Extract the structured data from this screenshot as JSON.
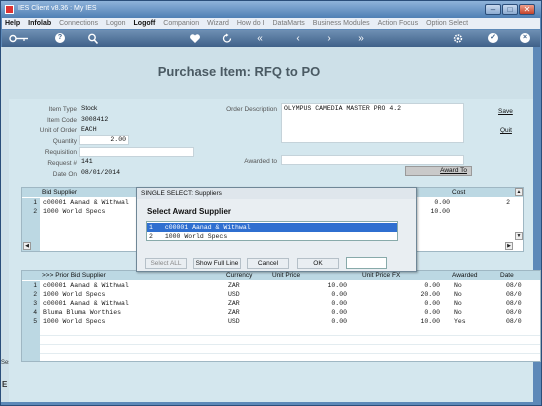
{
  "window": {
    "title": "IES Client v8.36 : My IES",
    "min_glyph": "–",
    "max_glyph": "□",
    "close_glyph": "✕"
  },
  "menu": [
    "Help",
    "Infolab",
    "Connections",
    "Logon",
    "Logoff",
    "Companion",
    "Wizard",
    "How do I",
    "DataMarts",
    "Business Modules",
    "Action Focus",
    "Option Select"
  ],
  "toolbar": {
    "icons": [
      "key-icon",
      "help-icon",
      "search-icon",
      "heart-icon",
      "refresh-icon",
      "back-icon",
      "left-icon",
      "right-icon",
      "forward-icon",
      "settings-icon",
      "check-icon",
      "close-icon"
    ],
    "glyphs": {
      "help": "?",
      "back": "«",
      "left": "‹",
      "right": "›",
      "forward": "»",
      "check": "✓",
      "close": "×"
    }
  },
  "page": {
    "title": "Purchase Item: RFQ to PO"
  },
  "form": {
    "item_type_label": "Item Type",
    "item_type": "Stock",
    "item_code_label": "Item Code",
    "item_code": "3008412",
    "unit_label": "Unit of Order",
    "unit": "EACH",
    "quantity_label": "Quantity",
    "quantity": "2.00",
    "requisition_label": "Requisition",
    "requisition": "",
    "request_label": "Request #",
    "request": "141",
    "date_label": "Date On",
    "date": "08/01/2014",
    "order_desc_label": "Order Description",
    "order_desc": "OLYMPUS CAMEDIA MASTER PRO 4.2",
    "awarded_to_label": "Awarded to",
    "awarded_to": ""
  },
  "actions": {
    "save": "Save",
    "quit": "Quit",
    "award_to": "Award To"
  },
  "bid_grid": {
    "headers": {
      "supplier": "Bid Supplier",
      "cost": "Cost"
    },
    "rows": [
      {
        "num": "1",
        "supplier": "c00001 Aanad & Withwal",
        "cost": "0.00",
        "cost2": "2"
      },
      {
        "num": "2",
        "supplier": "1000 World Specs",
        "cost": "10.00",
        "cost2": ""
      }
    ]
  },
  "prior_grid": {
    "headers": {
      "supplier": ">>> Prior Bid Supplier",
      "currency": "Currency",
      "unit_price": "Unit Price",
      "unit_price_fx": "Unit Price FX",
      "awarded": "Awarded",
      "date": "Date"
    },
    "rows": [
      {
        "num": "1",
        "supplier": "c00001 Aanad & Withwal",
        "currency": "ZAR",
        "unit_price": "10.00",
        "unit_price_fx": "0.00",
        "awarded": "No",
        "date": "08/0"
      },
      {
        "num": "2",
        "supplier": "1000 World Specs",
        "currency": "USD",
        "unit_price": "0.00",
        "unit_price_fx": "20.00",
        "awarded": "No",
        "date": "08/0"
      },
      {
        "num": "3",
        "supplier": "c00001 Aanad & Withwal",
        "currency": "ZAR",
        "unit_price": "0.00",
        "unit_price_fx": "0.00",
        "awarded": "No",
        "date": "08/0"
      },
      {
        "num": "4",
        "supplier": "Bluma Bluma Worthies",
        "currency": "ZAR",
        "unit_price": "0.00",
        "unit_price_fx": "0.00",
        "awarded": "No",
        "date": "08/0"
      },
      {
        "num": "5",
        "supplier": "1000 World Specs",
        "currency": "USD",
        "unit_price": "0.00",
        "unit_price_fx": "10.00",
        "awarded": "Yes",
        "date": "08/0"
      }
    ]
  },
  "dialog": {
    "title": "SINGLE SELECT: Suppliers",
    "heading": "Select Award Supplier",
    "options": [
      {
        "num": "1",
        "label": "c00001 Aanad & Withwal",
        "selected": true
      },
      {
        "num": "2",
        "label": "1000 World Specs",
        "selected": false
      }
    ],
    "buttons": {
      "select_all": "Select ALL",
      "full_line": "Show Full Line",
      "cancel": "Cancel",
      "ok": "OK"
    },
    "input_value": ""
  },
  "sidebar": {
    "label": "Ses",
    "letter": "E"
  },
  "colors": {
    "accent": "#2f6fd0",
    "content_bg": "#d4e7ee",
    "title_bar": "#4f7fb4"
  }
}
